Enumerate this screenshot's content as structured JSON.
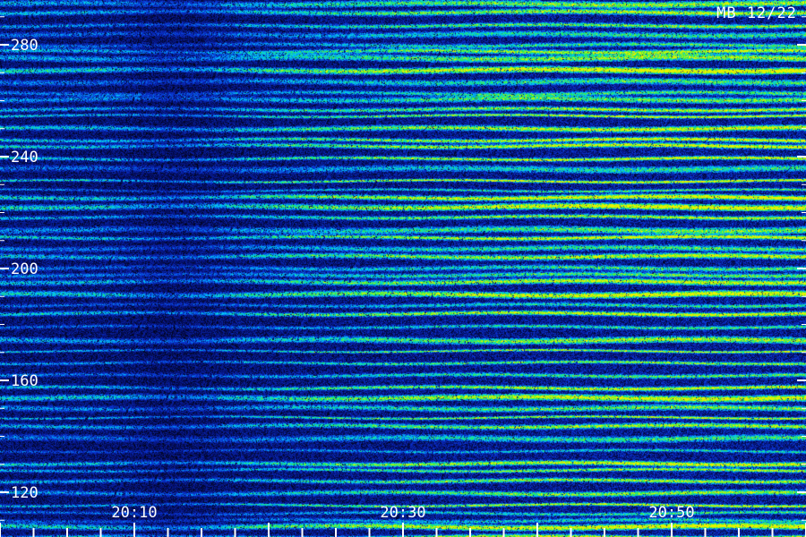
{
  "chart_data": {
    "type": "heatmap",
    "stamp": "MB 12/22",
    "colormap": [
      "#000000",
      "#06127a",
      "#0a37d8",
      "#00c8ff",
      "#27f04a",
      "#eaf200"
    ],
    "y_axis": {
      "ticks": [
        "280",
        "240",
        "200",
        "160",
        "120"
      ],
      "tick_values": [
        280,
        240,
        200,
        160,
        120
      ],
      "range": [
        104,
        296
      ],
      "minor_step": 10
    },
    "x_axis": {
      "ticks": [
        "20:10",
        "20:30",
        "20:50"
      ],
      "tick_minutes": [
        10,
        30,
        50
      ],
      "range_minutes": [
        0,
        60
      ],
      "minor_step_minutes": 2.5
    },
    "intensity_profile": {
      "description_times_minutes": [
        0,
        8,
        12,
        15,
        18,
        22,
        30,
        40,
        50,
        60
      ],
      "relative_level": [
        0.55,
        0.5,
        0.35,
        0.4,
        0.55,
        0.65,
        0.8,
        0.92,
        1.0,
        1.0
      ]
    }
  }
}
